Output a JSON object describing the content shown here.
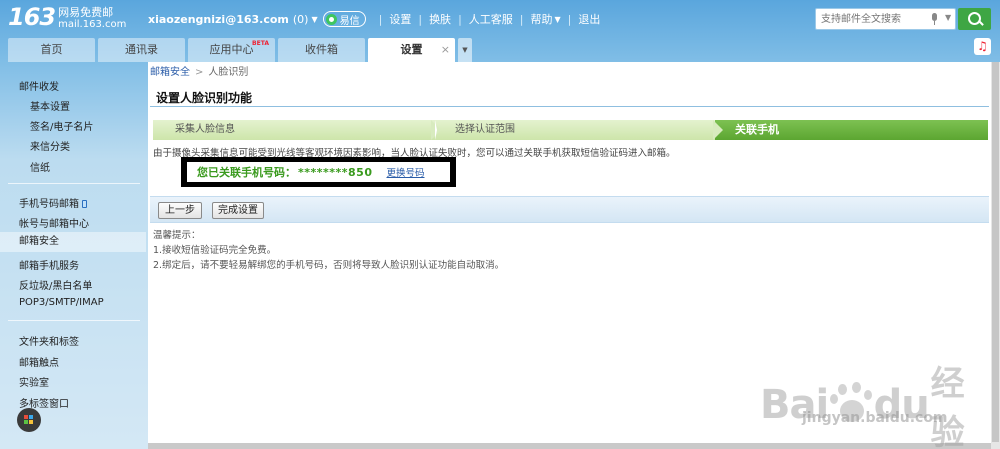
{
  "header": {
    "logo_number": "163",
    "logo_cn": "网易免费邮",
    "logo_domain": "mail.163.com",
    "user_email": "xiaozengnizi@163.com",
    "unread_count": "(0)",
    "yixin_label": "易信",
    "links": [
      "设置",
      "换肤",
      "人工客服",
      "帮助",
      "退出"
    ],
    "search_placeholder": "支持邮件全文搜索"
  },
  "tabs": [
    {
      "label": "首页"
    },
    {
      "label": "通讯录"
    },
    {
      "label": "应用中心",
      "badge": "BETA"
    },
    {
      "label": "收件箱"
    },
    {
      "label": "设置",
      "active": true
    }
  ],
  "sidebar": {
    "group1_title": "邮件收发",
    "group1_items": [
      "基本设置",
      "签名/电子名片",
      "来信分类",
      "信纸"
    ],
    "group2_items": [
      "手机号码邮箱",
      "帐号与邮箱中心",
      "邮箱安全",
      "邮箱手机服务",
      "反垃圾/黑白名单",
      "POP3/SMTP/IMAP"
    ],
    "group3_items": [
      "文件夹和标签",
      "邮箱触点",
      "实验室",
      "多标签窗口"
    ]
  },
  "main": {
    "breadcrumb_link": "邮箱安全",
    "breadcrumb_sep": ">",
    "breadcrumb_current": "人脸识别",
    "title": "设置人脸识别功能",
    "steps": [
      "采集人脸信息",
      "选择认证范围",
      "关联手机"
    ],
    "description": "由于摄像头采集信息可能受到光线等客观环境因素影响，当人脸认证失败时，您可以通过关联手机获取短信验证码进入邮箱。",
    "phone_label": "您已关联手机号码：",
    "phone_number": "********850",
    "change_link": "更换号码",
    "btn_prev": "上一步",
    "btn_done": "完成设置",
    "tips_title": "温馨提示：",
    "tips": [
      "1.接收短信验证码完全免费。",
      "2.绑定后，请不要轻易解绑您的手机号码，否则将导致人脸识别认证功能自动取消。"
    ]
  },
  "watermark": {
    "brand": "Bai",
    "brand2": "du",
    "cn": "经验",
    "url": "jingyan.baidu.com"
  },
  "colors": {
    "accent_green": "#5ca631",
    "link_blue": "#2a5ca8",
    "header_blue": "#5aa6dd"
  }
}
